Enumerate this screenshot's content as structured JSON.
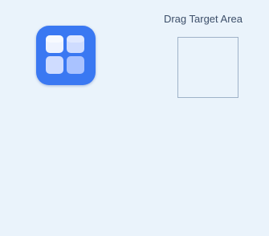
{
  "drag_source": {
    "icon": "app-grid-icon"
  },
  "drag_target": {
    "label": "Drag Target Area"
  },
  "colors": {
    "background": "#eaf3fb",
    "icon_blue": "#3a78f2",
    "target_border": "#9fb2c8",
    "label_text": "#3d4f6a"
  }
}
